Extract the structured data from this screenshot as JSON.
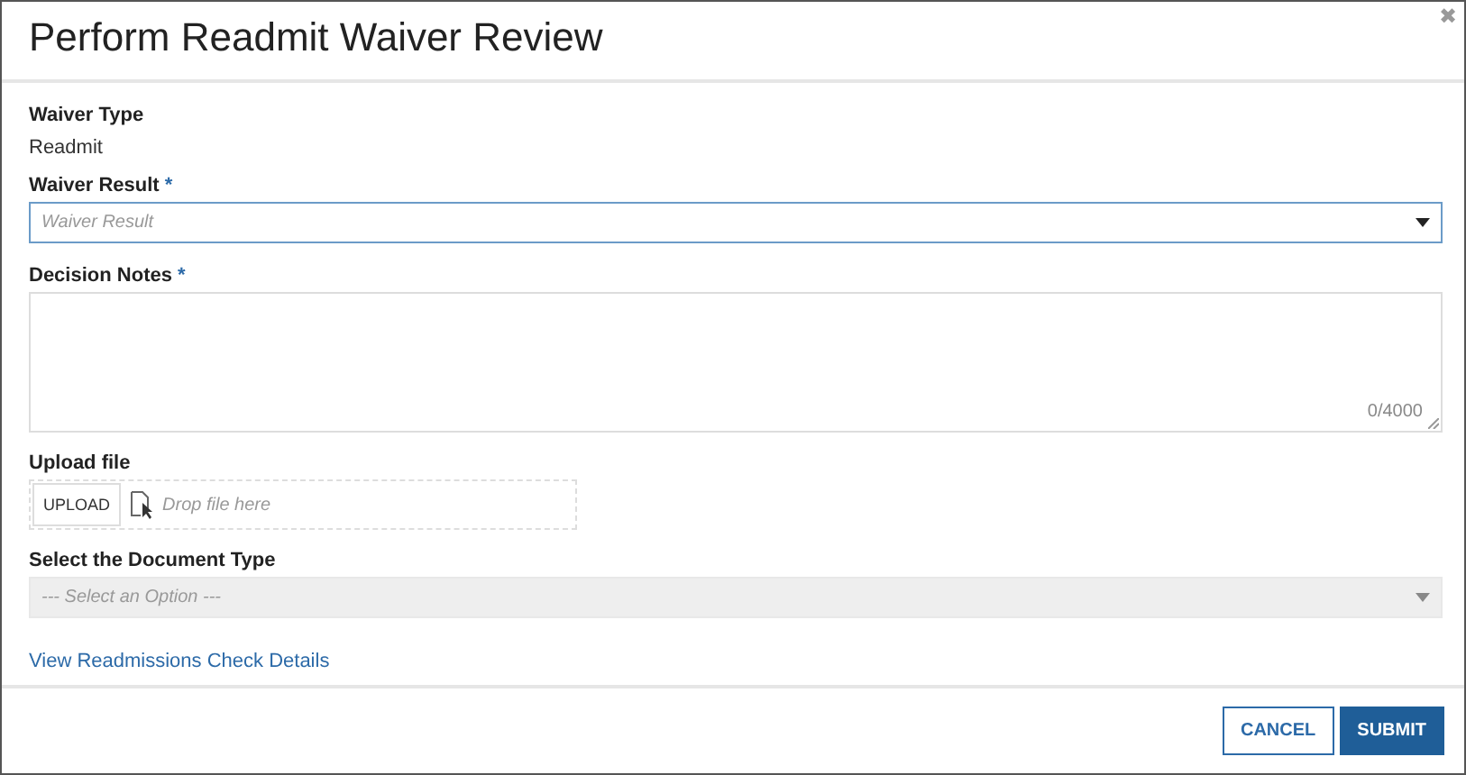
{
  "dialog": {
    "title": "Perform Readmit Waiver Review",
    "close_icon": "✖"
  },
  "fields": [
    {
      "kind": "readonly",
      "label": "Waiver Type",
      "value": "Readmit"
    },
    {
      "kind": "select",
      "label": "Waiver Result",
      "required_mark": "*",
      "placeholder": "Waiver Result",
      "focused": true,
      "disabled": false
    },
    {
      "kind": "textarea",
      "label": "Decision Notes",
      "required_mark": "*",
      "counter": "0/4000"
    },
    {
      "kind": "upload",
      "label": "Upload file",
      "button": "UPLOAD",
      "hint": "Drop file here"
    },
    {
      "kind": "select",
      "label": "Select the Document Type",
      "placeholder": "--- Select an Option ---",
      "focused": false,
      "disabled": true
    }
  ],
  "link": "View Readmissions Check Details",
  "buttons": [
    {
      "label": "CANCEL",
      "kind": "secondary"
    },
    {
      "label": "SUBMIT",
      "kind": "primary"
    }
  ]
}
